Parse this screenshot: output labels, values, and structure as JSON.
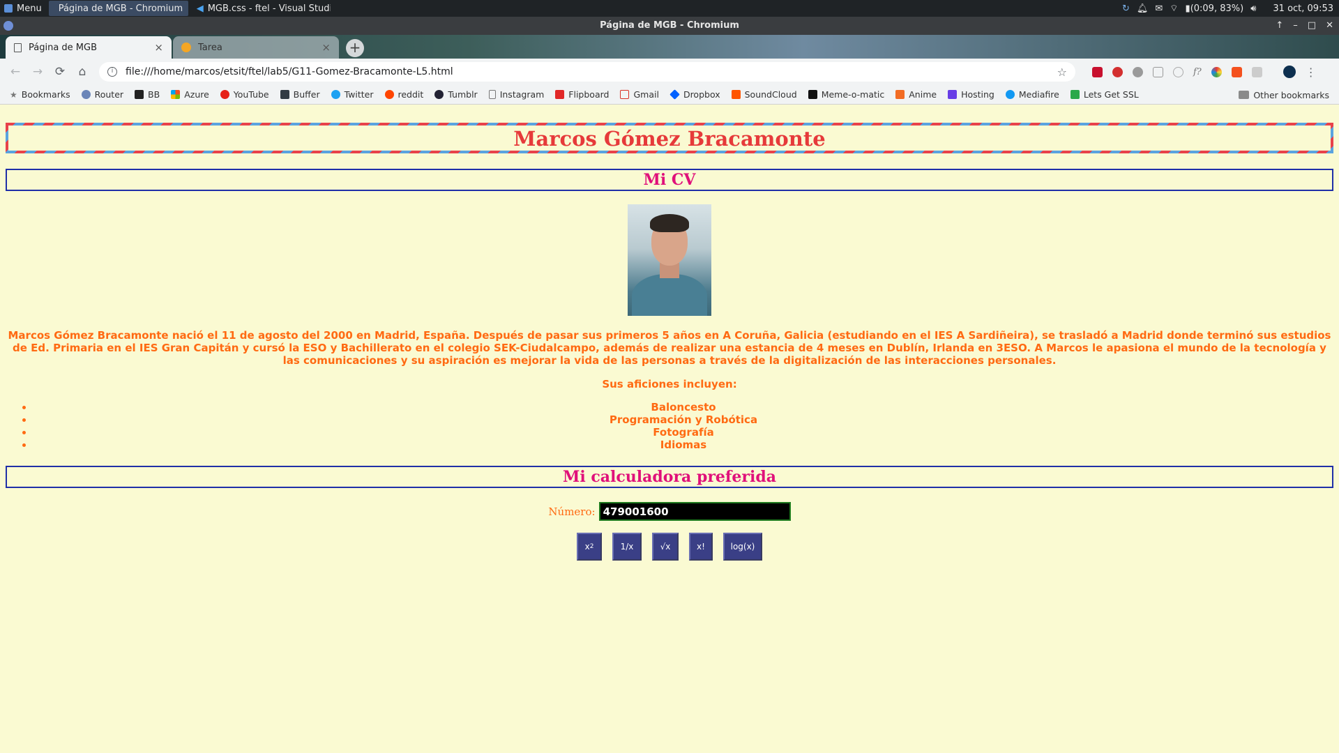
{
  "panel": {
    "menu_label": "Menu",
    "tasks": [
      "Página de MGB - Chromium",
      "MGB.css - ftel - Visual Studi..."
    ],
    "battery": "(0:09, 83%)",
    "datetime": "31 oct, 09:53"
  },
  "window": {
    "title": "Página de MGB - Chromium"
  },
  "tabs": [
    {
      "label": "Página de MGB",
      "close": "×"
    },
    {
      "label": "Tarea",
      "close": "×"
    }
  ],
  "newtab": "+",
  "toolbar": {
    "back": "←",
    "forward": "→",
    "reload": "⟳",
    "home": "⌂",
    "url": "file:///home/marcos/etsit/ftel/lab5/G11-Gomez-Bracamonte-L5.html",
    "star": "☆",
    "menu": "⋮"
  },
  "bookmarks": {
    "items": [
      "Bookmarks",
      "Router",
      "BB",
      "Azure",
      "YouTube",
      "Buffer",
      "Twitter",
      "reddit",
      "Tumblr",
      "Instagram",
      "Flipboard",
      "Gmail",
      "Dropbox",
      "SoundCloud",
      "Meme-o-matic",
      "Anime",
      "Hosting",
      "Mediafire",
      "Lets Get SSL"
    ],
    "other": "Other bookmarks"
  },
  "colors": {
    "title": "#e63a3a",
    "heading": "#e0107a",
    "text": "#ff6a12",
    "page_bg": "#fafad2",
    "button": "#3a3f86"
  },
  "page": {
    "title": "Marcos Gómez Bracamonte",
    "section_cv": "Mi CV",
    "bio": "Marcos Gómez Bracamonte nació el 11 de agosto del 2000 en Madrid, España. Después de pasar sus primeros 5 años en A Coruña, Galicia (estudiando en el IES A Sardiñeira), se trasladó a Madrid donde terminó sus estudios de Ed. Primaria en el IES Gran Capitán y cursó la ESO y Bachillerato en el colegio SEK-Ciudalcampo, además de realizar una estancia de 4 meses en Dublín, Irlanda en 3ESO. A Marcos le apasiona el mundo de la tecnología y las comunicaciones y su aspiración es mejorar la vida de las personas a través de la digitalización de las interacciones personales.",
    "hobbies_title": "Sus aficiones incluyen:",
    "hobbies": [
      "Baloncesto",
      "Programación y Robótica",
      "Fotografía",
      "Idiomas"
    ],
    "section_calc": "Mi calculadora preferida",
    "calc_label": "Número:",
    "calc_value": "479001600",
    "buttons": {
      "square": "x",
      "square_sup": "2",
      "inverse": "1/x",
      "sqrt": "√x",
      "factorial": "x!",
      "log": "log(x)"
    }
  }
}
